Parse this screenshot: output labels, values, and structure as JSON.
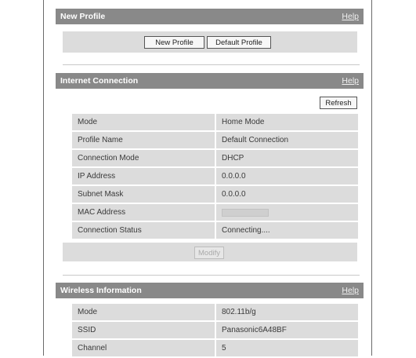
{
  "new_profile": {
    "title": "New Profile",
    "help": "Help",
    "new_profile_button": "New Profile",
    "default_profile_button": "Default Profile"
  },
  "internet_connection": {
    "title": "Internet Connection",
    "help": "Help",
    "refresh_button": "Refresh",
    "rows": [
      {
        "label": "Mode",
        "value": "Home Mode"
      },
      {
        "label": "Profile Name",
        "value": "Default Connection"
      },
      {
        "label": "Connection Mode",
        "value": "DHCP"
      },
      {
        "label": "IP Address",
        "value": "0.0.0.0"
      },
      {
        "label": "Subnet Mask",
        "value": "0.0.0.0"
      },
      {
        "label": "MAC Address",
        "value": ""
      },
      {
        "label": "Connection Status",
        "value": "Connecting...."
      }
    ],
    "modify_button": "Modify"
  },
  "wireless_information": {
    "title": "Wireless Information",
    "help": "Help",
    "rows": [
      {
        "label": "Mode",
        "value": "802.11b/g"
      },
      {
        "label": "SSID",
        "value": "Panasonic6A48BF"
      },
      {
        "label": "Channel",
        "value": "5"
      }
    ]
  }
}
